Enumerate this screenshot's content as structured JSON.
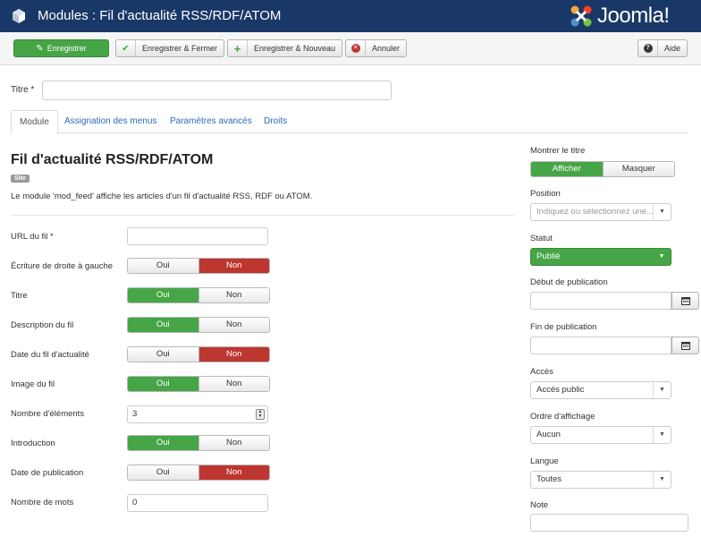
{
  "header": {
    "title": "Modules : Fil d'actualité RSS/RDF/ATOM",
    "brand": "Joomla!"
  },
  "toolbar": {
    "save": "Enregistrer",
    "save_close": "Enregistrer & Fermer",
    "save_new": "Enregistrer & Nouveau",
    "cancel": "Annuler",
    "help": "Aide"
  },
  "form": {
    "title_label": "Titre *",
    "title_value": ""
  },
  "tabs": [
    "Module",
    "Assignation des menus",
    "Paramètres avancés",
    "Droits"
  ],
  "module": {
    "heading": "Fil d'actualité RSS/RDF/ATOM",
    "badge": "Site",
    "description": "Le module 'mod_feed' affiche les articles d'un fil d'actualité RSS, RDF ou ATOM.",
    "fields": {
      "url_label": "URL du fil *",
      "url_value": "",
      "rtl_label": "Écriture de droite à gauche",
      "title_label": "Titre",
      "desc_label": "Description du fil",
      "date_label": "Date du fil d'actualité",
      "image_label": "Image du fil",
      "count_label": "Nombre d'éléments",
      "count_value": "3",
      "intro_label": "Introduction",
      "pubdate_label": "Date de publication",
      "words_label": "Nombre de mots",
      "words_value": "0",
      "yes": "Oui",
      "no": "Non"
    }
  },
  "side": {
    "show_title_label": "Montrer le titre",
    "show": "Afficher",
    "hide": "Masquer",
    "position_label": "Position",
    "position_placeholder": "Indiquez ou sélectionnez une...",
    "status_label": "Statut",
    "status_value": "Publié",
    "start_label": "Début de publication",
    "end_label": "Fin de publication",
    "access_label": "Accès",
    "access_value": "Accès public",
    "order_label": "Ordre d'affichage",
    "order_value": "Aucun",
    "language_label": "Langue",
    "language_value": "Toutes",
    "note_label": "Note"
  },
  "colors": {
    "header": "#1a3867",
    "green": "#46a546",
    "red": "#bd362f",
    "link": "#2a69b8"
  }
}
